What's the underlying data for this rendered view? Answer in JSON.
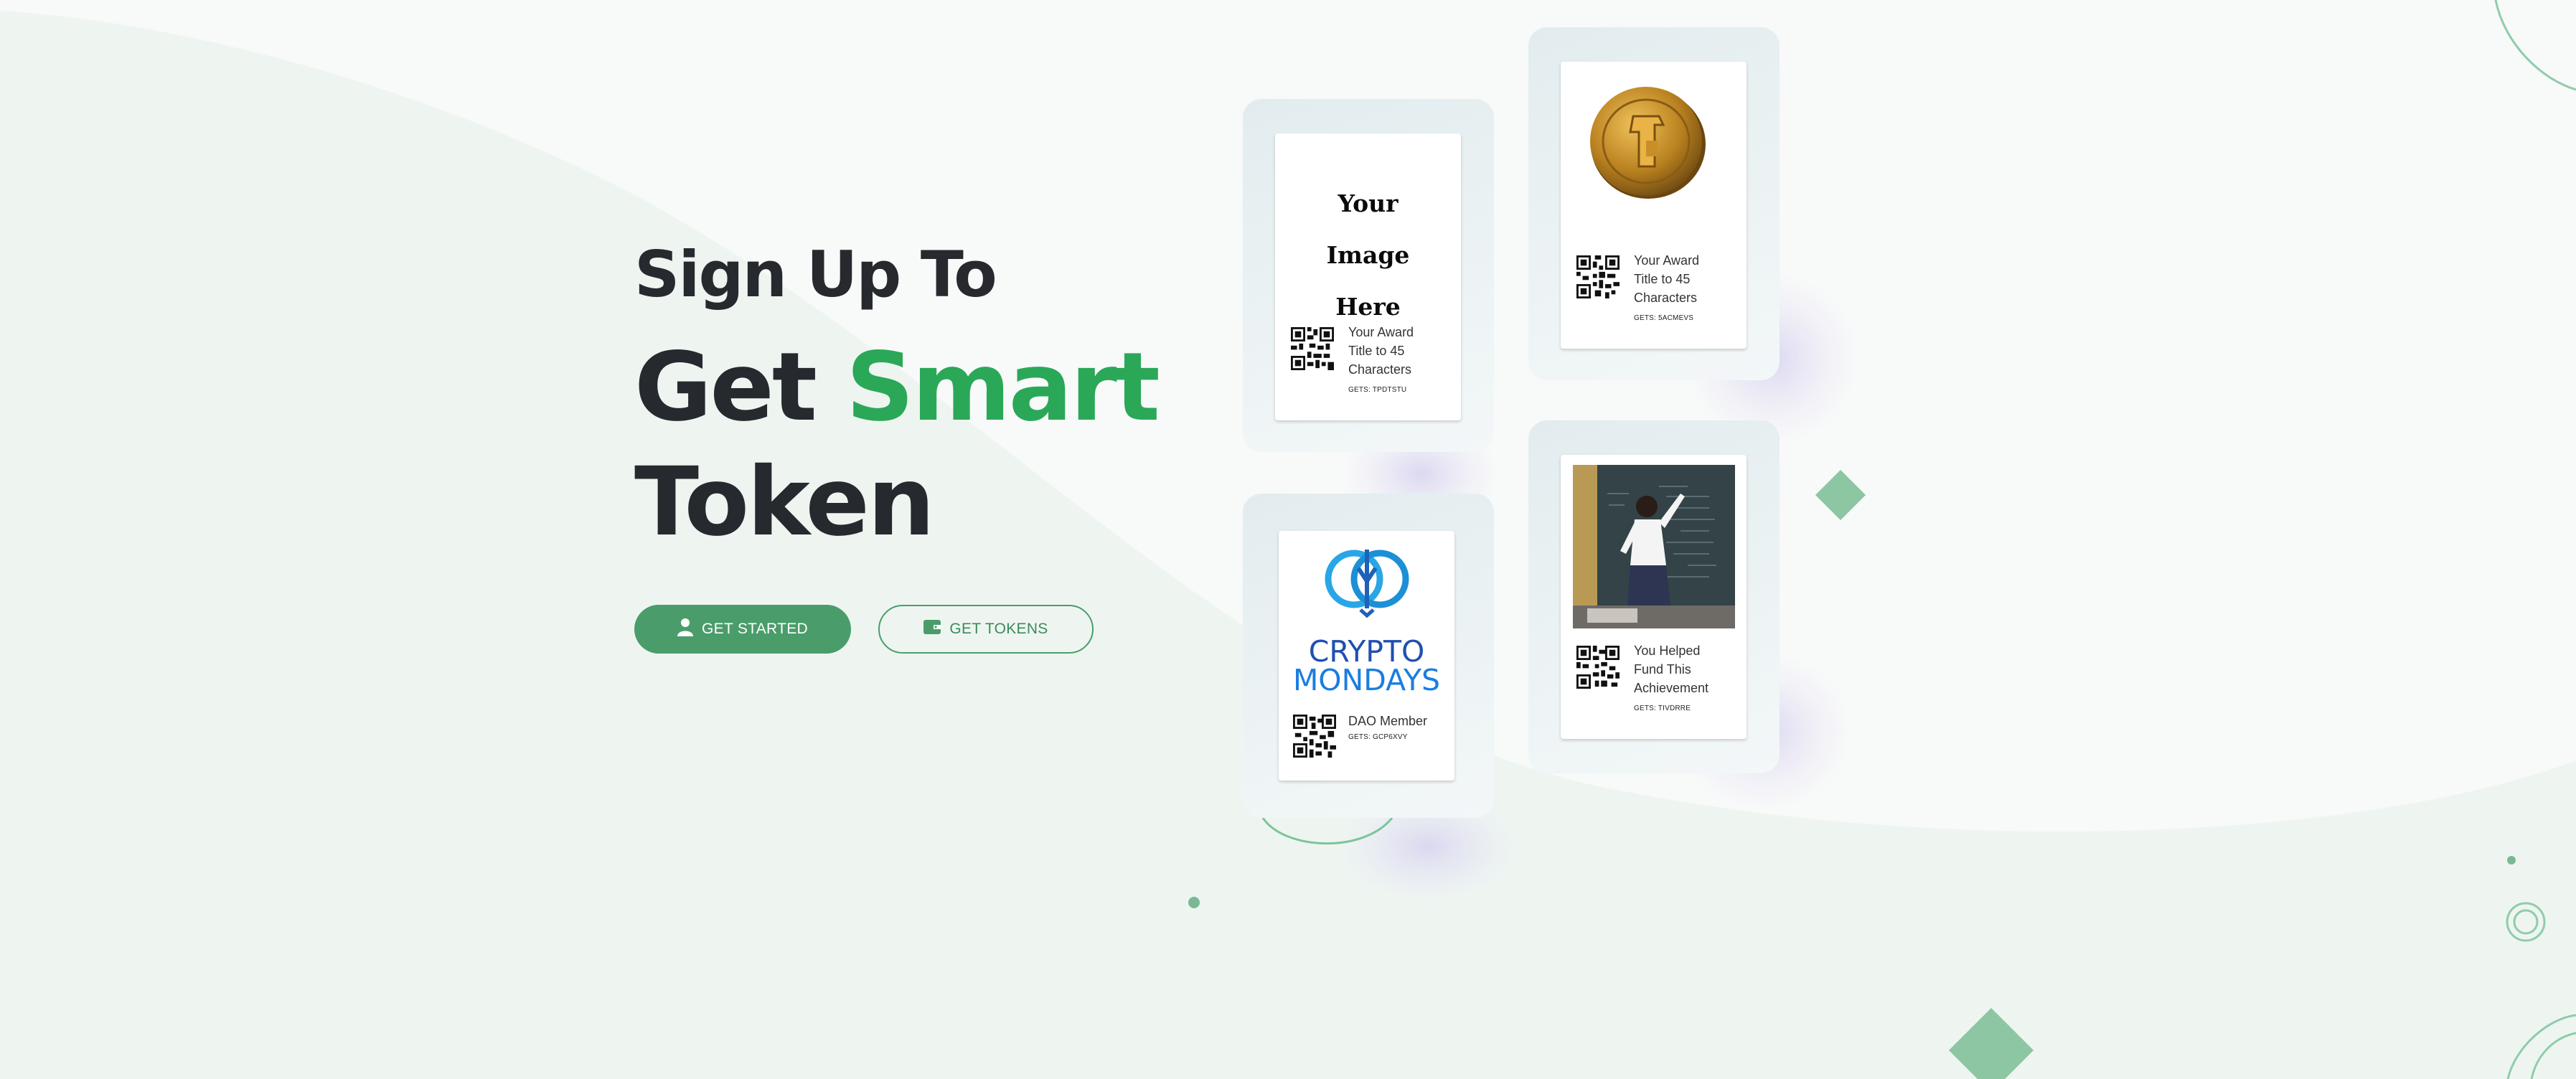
{
  "hero": {
    "line1": "Sign Up To",
    "line2_dark": "Get",
    "line2_green": "Smart",
    "line3": "Token"
  },
  "buttons": {
    "get_started": "GET STARTED",
    "get_tokens": "GET TOKENS"
  },
  "cards": {
    "image_placeholder": {
      "image_text": "Your Image Here",
      "title": "Your Award Title to 45 Characters",
      "code": "GETS: TPDTSTU"
    },
    "coin": {
      "title": "Your Award Title to 45 Characters",
      "code": "GETS: 5ACMEVS"
    },
    "crypto_mondays": {
      "logo_line1": "CRYPTO",
      "logo_line2": "MONDAYS",
      "title": "DAO Member",
      "code": "GETS: GCP6XVY"
    },
    "teacher": {
      "title": "You Helped Fund This Achievement",
      "code": "GETS: TIVDRRE"
    }
  },
  "icons": [
    "user-icon",
    "wallet-icon",
    "qr-code-icon",
    "diamond-icon"
  ],
  "colors": {
    "accent_green": "#2aa858",
    "button_green": "#4a9d6a",
    "dark_text": "#262a2e"
  }
}
